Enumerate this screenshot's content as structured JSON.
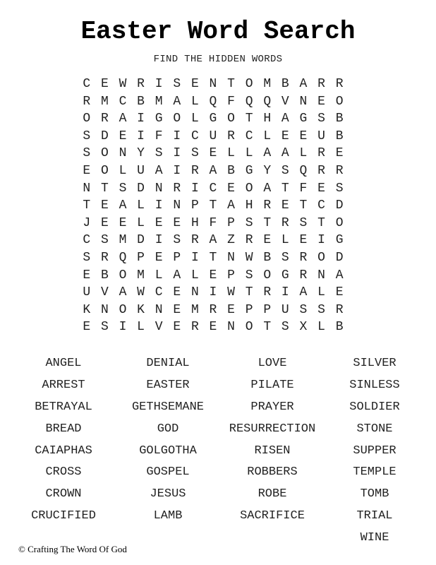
{
  "title": "Easter Word Search",
  "subtitle": "FIND THE HIDDEN WORDS",
  "grid_rows": [
    "CEWRISENTOMBARR",
    "RMCBMALQFQQVNEO",
    "ORAIGOLGOTHAGSB",
    "SDEIFICURCLEEUB",
    "SONYSISELLAALRE",
    "EOLUAIRABGYSQRR",
    "NTSDNRICEOATFES",
    "TEALINPTAHRETCD",
    "JEELEEHFPSTRSTO",
    "CSMDISRAZRELEIG",
    "SRQPEPITNWBSROD",
    "EBOMLALEPSOGRNA",
    "UVAWCENIWTRIALE",
    "KNOKNEMREPPUSSR",
    "ESILVERENOTSXLB"
  ],
  "word_columns": [
    [
      "ANGEL",
      "ARREST",
      "BETRAYAL",
      "BREAD",
      "CAIAPHAS",
      "CROSS",
      "CROWN",
      "CRUCIFIED"
    ],
    [
      "DENIAL",
      "EASTER",
      "GETHSEMANE",
      "GOD",
      "GOLGOTHA",
      "GOSPEL",
      "JESUS",
      "LAMB"
    ],
    [
      "LOVE",
      "PILATE",
      "PRAYER",
      "RESURRECTION",
      "RISEN",
      "ROBBERS",
      "ROBE",
      "SACRIFICE"
    ],
    [
      "SILVER",
      "SINLESS",
      "SOLDIER",
      "STONE",
      "SUPPER",
      "TEMPLE",
      "TOMB",
      "TRIAL",
      "WINE"
    ]
  ],
  "copyright": "© Crafting The Word Of God"
}
